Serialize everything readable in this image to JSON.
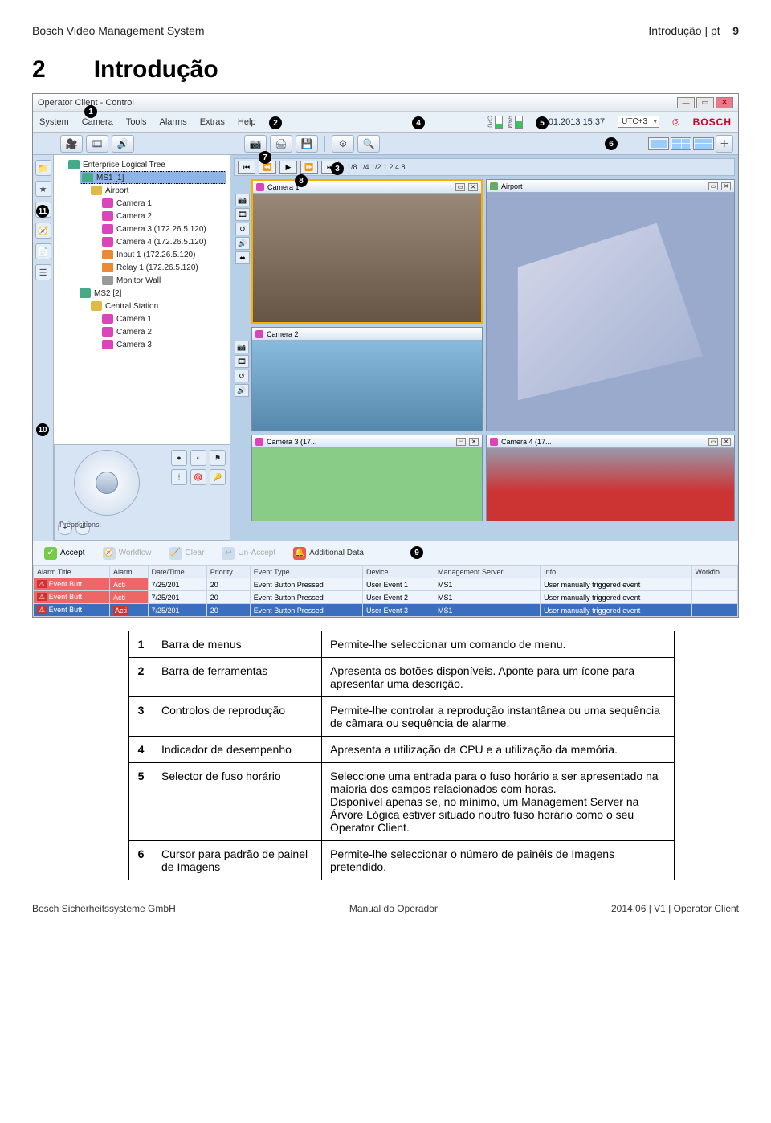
{
  "header": {
    "left": "Bosch Video Management System",
    "right": "Introdução | pt",
    "pageno": "9"
  },
  "section": {
    "num": "2",
    "title": "Introdução"
  },
  "app": {
    "title": "Operator Client - Control",
    "menu": [
      "System",
      "Camera",
      "Tools",
      "Alarms",
      "Extras",
      "Help"
    ],
    "datetime": "16.01.2013 15:37",
    "perf": {
      "cpu_label": "CPU",
      "ram_label": "RAM"
    },
    "tz": "UTC+3",
    "brand": "BOSCH",
    "playback_text": "1/8 1/4 1/2  1  2  4  8",
    "tree": {
      "root": "Enterprise Logical Tree",
      "ms1": "MS1 [1]",
      "airport": "Airport",
      "cams": [
        "Camera 1",
        "Camera 2",
        "Camera 3 (172.26.5.120)",
        "Camera 4 (172.26.5.120)",
        "Input 1 (172.26.5.120)",
        "Relay 1 (172.26.5.120)",
        "Monitor Wall"
      ],
      "ms2": "MS2 [2]",
      "central": "Central Station",
      "cs_cams": [
        "Camera 1",
        "Camera 2",
        "Camera 3"
      ]
    },
    "panes": {
      "cam1": "Camera 1",
      "airport": "Airport",
      "cam2": "Camera 2",
      "cam3": "Camera 3 (17...",
      "cam4": "Camera 4 (17..."
    },
    "prepositions": "Prepositions:",
    "alarm_buttons": {
      "accept": "Accept",
      "workflow": "Workflow",
      "clear": "Clear",
      "unaccept": "Un-Accept",
      "additional": "Additional Data"
    },
    "alarm_cols": [
      "Alarm Title",
      "Alarm",
      "Date/Time",
      "Priority",
      "Event Type",
      "Device",
      "Management Server",
      "Info",
      "Workflo"
    ],
    "alarm_rows": [
      {
        "title": "Event Butt",
        "al": "Acti",
        "dt": "7/25/201",
        "pr": "20",
        "et": "Event Button Pressed",
        "dev": "User Event 1",
        "ms": "MS1",
        "info": "User manually triggered event"
      },
      {
        "title": "Event Butt",
        "al": "Acti",
        "dt": "7/25/201",
        "pr": "20",
        "et": "Event Button Pressed",
        "dev": "User Event 2",
        "ms": "MS1",
        "info": "User manually triggered event"
      },
      {
        "title": "Event Butt",
        "al": "Acti",
        "dt": "7/25/201",
        "pr": "20",
        "et": "Event Button Pressed",
        "dev": "User Event 3",
        "ms": "MS1",
        "info": "User manually triggered event"
      }
    ]
  },
  "rows": [
    {
      "n": "1",
      "name": "Barra de menus",
      "desc": "Permite-lhe seleccionar um comando de menu."
    },
    {
      "n": "2",
      "name": "Barra de ferramentas",
      "desc": "Apresenta os botões disponíveis. Aponte para um ícone para apresentar uma descrição."
    },
    {
      "n": "3",
      "name": "Controlos de reprodução",
      "desc": "Permite-lhe controlar a reprodução instantânea ou uma sequência de câmara ou sequência de alarme."
    },
    {
      "n": "4",
      "name": "Indicador de desempenho",
      "desc": "Apresenta a utilização da CPU e a utilização da memória."
    },
    {
      "n": "5",
      "name": "Selector de fuso horário",
      "desc": "Seleccione uma entrada para o fuso horário a ser apresentado na maioria dos campos relacionados com horas.\nDisponível apenas se, no mínimo, um Management Server na Árvore Lógica estiver situado noutro fuso horário como o seu Operator Client."
    },
    {
      "n": "6",
      "name": "Cursor para padrão de painel de Imagens",
      "desc": "Permite-lhe seleccionar o número de painéis de Imagens pretendido."
    }
  ],
  "footer": {
    "left": "Bosch Sicherheitssysteme GmbH",
    "center": "Manual do Operador",
    "right": "2014.06 | V1 | Operator Client"
  }
}
